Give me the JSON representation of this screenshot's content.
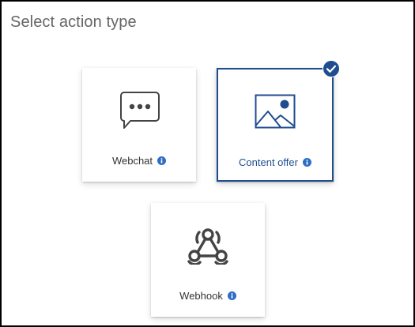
{
  "header": {
    "title": "Select action type"
  },
  "cards": [
    {
      "label": "Webchat",
      "icon": "chat-bubble-icon",
      "selected": false
    },
    {
      "label": "Content offer",
      "icon": "image-icon",
      "selected": true
    },
    {
      "label": "Webhook",
      "icon": "webhook-icon",
      "selected": false
    }
  ],
  "colors": {
    "accent": "#1f4d8f",
    "info": "#2e6ec2",
    "icon": "#444444",
    "title": "#666666"
  }
}
